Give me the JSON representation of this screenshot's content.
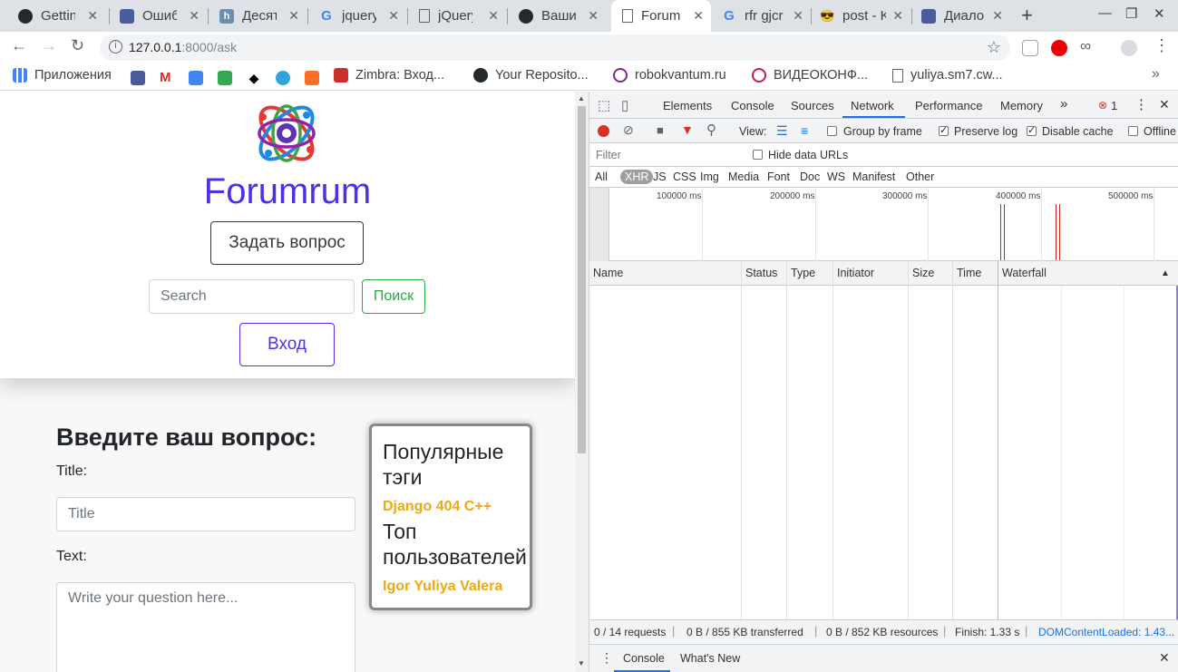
{
  "browser": {
    "tabs": [
      {
        "title": "Getting",
        "icon": "github-icon"
      },
      {
        "title": "Ошибк",
        "icon": "chat-icon"
      },
      {
        "title": "Десять",
        "icon": "habr-icon"
      },
      {
        "title": "jquery",
        "icon": "google-icon"
      },
      {
        "title": "jQuery",
        "icon": "page-icon"
      },
      {
        "title": "Ваши",
        "icon": "github-icon"
      },
      {
        "title": "Forum",
        "icon": "page-icon",
        "active": true
      },
      {
        "title": "rfr gjcr",
        "icon": "google-icon"
      },
      {
        "title": "post - K",
        "icon": "sunglasses-icon"
      },
      {
        "title": "Диало",
        "icon": "chat-icon"
      }
    ],
    "url_host": "127.0.0.1",
    "url_path": ":8000/ask",
    "info_glyph": "i",
    "bookmarks": [
      {
        "label": "Приложения",
        "icon": "apps-grid-icon"
      },
      {
        "label": "Zimbra: Вход...",
        "icon": "zimbra-icon"
      },
      {
        "label": "Your Reposito...",
        "icon": "github-icon"
      },
      {
        "label": "robokvantum.ru",
        "icon": "robot-icon"
      },
      {
        "label": "ВИДЕОКОНФ...",
        "icon": "video-icon"
      },
      {
        "label": "yuliya.sm7.cw...",
        "icon": "page-icon"
      }
    ]
  },
  "site": {
    "brand": "Forumrum",
    "ask_button": "Задать вопрос",
    "search_placeholder": "Search",
    "search_button": "Поиск",
    "login_button": "Вход",
    "form_heading": "Введите ваш вопрос:",
    "title_label": "Title:",
    "title_placeholder": "Title",
    "text_label": "Text:",
    "text_placeholder": "Write your question here...",
    "sidebar": {
      "popular_tags_heading_line1": "Популярные",
      "popular_tags_heading_line2": "тэги",
      "tags": "Django 404 C++",
      "top_users_heading_line1": "Топ",
      "top_users_heading_line2": "пользователей",
      "users": "Igor Yuliya Valera"
    },
    "colors": {
      "brand": "#4b32e8",
      "success": "#28a745",
      "tags": "#f0a810"
    }
  },
  "devtools": {
    "tabs": [
      "Elements",
      "Console",
      "Sources",
      "Network",
      "Performance",
      "Memory"
    ],
    "active_tab": "Network",
    "error_count": "1",
    "view_label": "View:",
    "group_by_frame": "Group by frame",
    "preserve_log": "Preserve log",
    "disable_cache": "Disable cache",
    "offline": "Offline",
    "filter_placeholder": "Filter",
    "hide_data_urls": "Hide data URLs",
    "filter_types": [
      "All",
      "XHR",
      "JS",
      "CSS",
      "Img",
      "Media",
      "Font",
      "Doc",
      "WS",
      "Manifest",
      "Other"
    ],
    "selected_type": "XHR",
    "timeline_ticks": [
      "100000 ms",
      "200000 ms",
      "300000 ms",
      "400000 ms",
      "500000 ms"
    ],
    "columns": [
      "Name",
      "Status",
      "Type",
      "Initiator",
      "Size",
      "Time",
      "Waterfall"
    ],
    "status": {
      "requests": "0 / 14 requests",
      "transferred": "0 B / 855 KB transferred",
      "resources": "0 B / 852 KB resources",
      "finish": "Finish: 1.33 s",
      "dcl": "DOMContentLoaded: 1.43..."
    },
    "drawer_tabs": [
      "Console",
      "What's New"
    ]
  }
}
